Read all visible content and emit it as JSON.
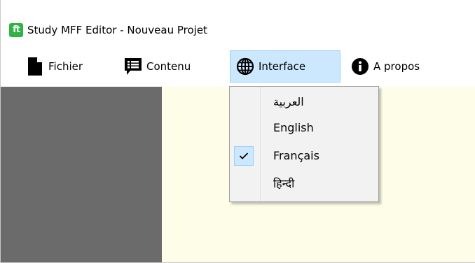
{
  "window": {
    "logo_text": "ft",
    "title": "Study MFF Editor - Nouveau Projet"
  },
  "menubar": {
    "items": [
      {
        "label": "Fichier",
        "icon": "file-icon"
      },
      {
        "label": "Contenu",
        "icon": "list-box-icon"
      },
      {
        "label": "Interface",
        "icon": "globe-icon",
        "active": true
      },
      {
        "label": "A propos",
        "icon": "info-icon"
      }
    ]
  },
  "interface_menu": {
    "items": [
      {
        "label": "العربية",
        "checked": false
      },
      {
        "label": "English",
        "checked": false
      },
      {
        "label": "Français",
        "checked": true
      },
      {
        "label": "हिन्दी",
        "checked": false
      }
    ],
    "check_glyph": "✓"
  },
  "colors": {
    "left_panel": "#6b6b6b",
    "content_bg": "#fefee8",
    "active_highlight": "#cce8ff",
    "logo_green": "#2fb344"
  }
}
